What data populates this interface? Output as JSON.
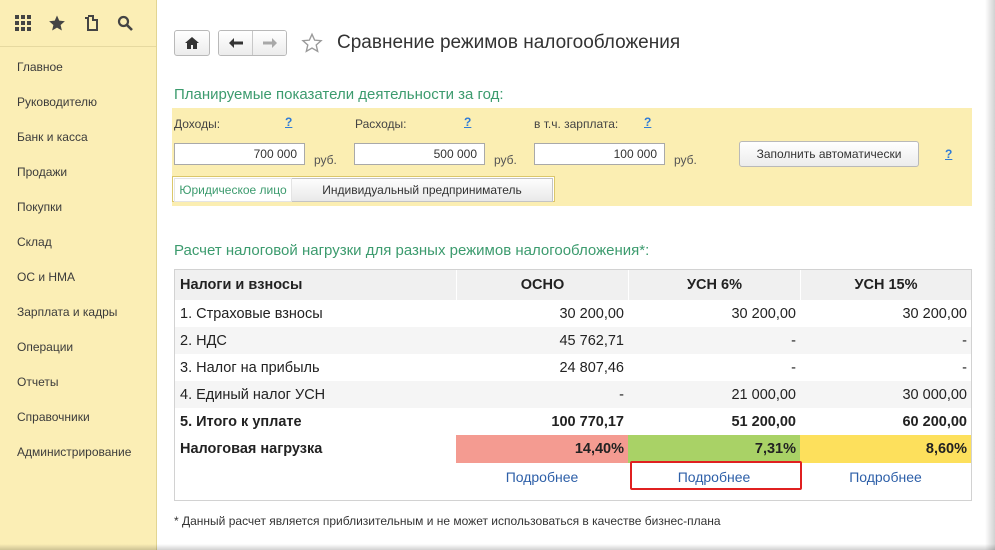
{
  "sidebar": {
    "toolbar": [
      {
        "icon": "apps-grid-icon"
      },
      {
        "icon": "star-icon"
      },
      {
        "icon": "history-icon"
      },
      {
        "icon": "search-icon"
      }
    ],
    "items": [
      {
        "label": "Главное"
      },
      {
        "label": "Руководителю"
      },
      {
        "label": "Банк и касса"
      },
      {
        "label": "Продажи"
      },
      {
        "label": "Покупки"
      },
      {
        "label": "Склад"
      },
      {
        "label": "ОС и НМА"
      },
      {
        "label": "Зарплата и кадры"
      },
      {
        "label": "Операции"
      },
      {
        "label": "Отчеты"
      },
      {
        "label": "Справочники"
      },
      {
        "label": "Администрирование"
      }
    ]
  },
  "header": {
    "title": "Сравнение режимов налогообложения",
    "icons": {
      "home": "home-icon",
      "back": "arrow-left-icon",
      "forward": "arrow-right-icon",
      "favorite": "star-outline-icon"
    }
  },
  "plan": {
    "title": "Планируемые показатели деятельности за год:",
    "income_label": "Доходы:",
    "expense_label": "Расходы:",
    "salary_label": "в т.ч. зарплата:",
    "help": "?",
    "income_value": "700 000",
    "expense_value": "500 000",
    "salary_value": "100 000",
    "currency": "руб.",
    "auto_fill_label": "Заполнить автоматически",
    "entity_options": [
      "Юридическое лицо",
      "Индивидуальный предприниматель"
    ],
    "entity_selected": "Юридическое лицо"
  },
  "calc": {
    "title": "Расчет налоговой нагрузки для разных режимов налогообложения*:",
    "columns": [
      "Налоги и взносы",
      "ОСНО",
      "УСН 6%",
      "УСН 15%"
    ],
    "rows": [
      [
        "1. Страховые взносы",
        "30 200,00",
        "30 200,00",
        "30 200,00"
      ],
      [
        "2. НДС",
        "45 762,71",
        "-",
        "-"
      ],
      [
        "3. Налог на прибыль",
        "24 807,46",
        "-",
        "-"
      ],
      [
        "4. Единый налог УСН",
        "-",
        "21 000,00",
        "30 000,00"
      ]
    ],
    "total": [
      "5. Итого к уплате",
      "100 770,17",
      "51 200,00",
      "60 200,00"
    ],
    "load": [
      "Налоговая нагрузка",
      "14,40%",
      "7,31%",
      "8,60%"
    ],
    "load_colors": [
      "#f49b91",
      "#a9d266",
      "#fde05c"
    ],
    "details_label": "Подробнее",
    "highlight_color": "#e02020"
  },
  "footnote": "* Данный расчет является приблизительным и не может использоваться в качестве бизнес-плана"
}
